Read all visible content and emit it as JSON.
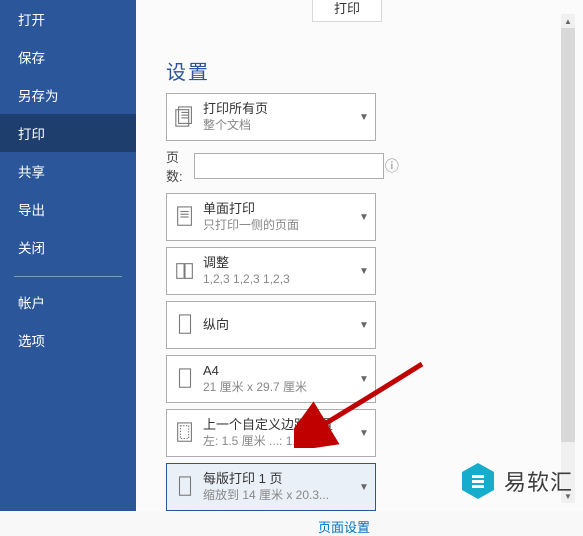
{
  "header": {
    "print_button": "打印",
    "cutoff_link": "..."
  },
  "sidebar": {
    "items": [
      {
        "label": "打开"
      },
      {
        "label": "保存"
      },
      {
        "label": "另存为"
      },
      {
        "label": "打印"
      },
      {
        "label": "共享"
      },
      {
        "label": "导出"
      },
      {
        "label": "关闭"
      },
      {
        "label": "帐户"
      },
      {
        "label": "选项"
      }
    ]
  },
  "settings": {
    "title": "设置",
    "pages_label": "页数:",
    "pages_value": "",
    "pages_placeholder": "",
    "page_setup_link": "页面设置",
    "options": [
      {
        "primary": "打印所有页",
        "secondary": "整个文档",
        "icon": "stack"
      },
      {
        "primary": "单面打印",
        "secondary": "只打印一侧的页面",
        "icon": "page"
      },
      {
        "primary": "调整",
        "secondary": "1,2,3    1,2,3    1,2,3",
        "icon": "collate"
      },
      {
        "primary": "纵向",
        "secondary": "",
        "icon": "portrait"
      },
      {
        "primary": "A4",
        "secondary": "21 厘米 x 29.7 厘米",
        "icon": "page"
      },
      {
        "primary": "上一个自定义边距设置",
        "secondary": "左:  1.5 厘米               ...:   1.5...",
        "icon": "margins"
      },
      {
        "primary": "每版打印 1 页",
        "secondary": "缩放到 14 厘米 x 20.3...",
        "icon": "page"
      }
    ]
  },
  "watermark": {
    "text": "易软汇"
  }
}
